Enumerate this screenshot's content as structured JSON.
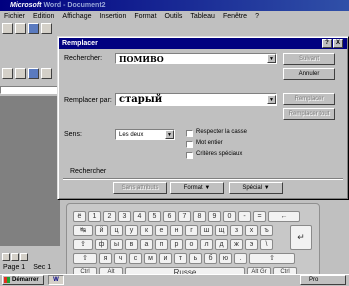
{
  "word": {
    "title_app": "Microsoft",
    "title_rest": " Word - Document2",
    "menu": [
      "Fichier",
      "Edition",
      "Affichage",
      "Insertion",
      "Format",
      "Outils",
      "Tableau",
      "Fenêtre",
      "?"
    ],
    "status": [
      "Page 1",
      "Sec 1"
    ]
  },
  "dialog": {
    "title": "Remplacer",
    "title_buttons": [
      "?",
      "X"
    ],
    "find_label": "Rechercher:",
    "find_value": "ПОМИВО",
    "replace_label": "Remplacer par:",
    "replace_value": "старый",
    "buttons": {
      "suivant": "Suivant",
      "annuler": "Annuler",
      "remplacer": "Remplacer",
      "remplacer_tout": "Remplacer tout",
      "sans_attributs": "Sans attributs",
      "format": "Format",
      "special": "Spécial"
    },
    "sens_label": "Sens:",
    "sens_value": "Les deux",
    "options": [
      "Respecter la casse",
      "Mot entier",
      "Critères spéciaux"
    ],
    "group_label": "Rechercher"
  },
  "keyboard": {
    "row1": [
      "ё",
      "1",
      "2",
      "3",
      "4",
      "5",
      "6",
      "7",
      "8",
      "9",
      "0",
      "-",
      "=",
      "←"
    ],
    "row2": [
      "↹",
      "й",
      "ц",
      "у",
      "к",
      "е",
      "н",
      "г",
      "ш",
      "щ",
      "з",
      "х",
      "ъ"
    ],
    "row3": [
      "⇪",
      "ф",
      "ы",
      "в",
      "а",
      "п",
      "р",
      "о",
      "л",
      "д",
      "ж",
      "э",
      "\\"
    ],
    "row4": [
      "⇧",
      "я",
      "ч",
      "с",
      "м",
      "и",
      "т",
      "ь",
      "б",
      "ю",
      ".",
      "⇧"
    ],
    "row5": [
      "Ctrl",
      "Alt",
      "Russe",
      "Alt Gr",
      "Ctrl"
    ],
    "enter": "↵"
  },
  "taskbar": {
    "start": "Démarrer",
    "word_task": "W",
    "pro_task": "Pro"
  }
}
